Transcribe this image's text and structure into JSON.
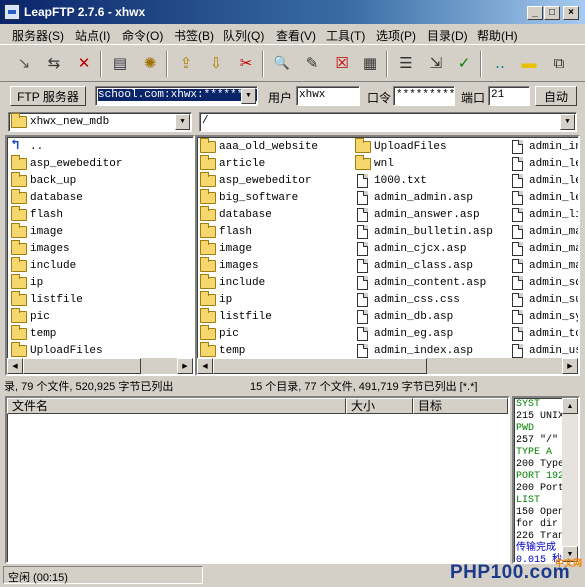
{
  "window": {
    "title": "LeapFTP 2.7.6 - xhwx",
    "min": "_",
    "max": "□",
    "close": "×"
  },
  "menu": [
    "服务器(S)",
    "站点(I)",
    "命令(O)",
    "书签(B)",
    "队列(Q)",
    "查看(V)",
    "工具(T)",
    "选项(P)",
    "目录(D)",
    "帮助(H)"
  ],
  "toolbar": {
    "icons": [
      "connect-icon",
      "quick-connect-icon",
      "disconnect-icon",
      "site-manager-icon",
      "settings-gear-icon",
      "upload-icon",
      "download-icon",
      "delete-icon",
      "find-icon",
      "edit-icon",
      "cancel-icon",
      "properties-icon",
      "queue-icon",
      "transfer-icon",
      "chart-icon",
      "dots-icon",
      "folder-icon",
      "maximize-icon"
    ],
    "glyphs": [
      "↘",
      "⇆",
      "✕",
      "▤",
      "✺",
      "⇪",
      "⇩",
      "✂",
      "🔍",
      "✎",
      "☒",
      "▦",
      "☰",
      "⇲",
      "✓",
      "‥",
      "▬",
      "⧉"
    ]
  },
  "connection": {
    "ftp_button": "FTP 服务器",
    "server_value": "school.com:xhwx:*********",
    "user_label": "用户",
    "user_value": "xhwx",
    "pass_label": "口令",
    "pass_value": "*********",
    "port_label": "端口",
    "port_value": "21",
    "auto_button": "自动"
  },
  "local": {
    "path": "xhwx_new_mdb",
    "parent": "..",
    "folders": [
      "asp_ewebeditor",
      "back_up",
      "database",
      "flash",
      "image",
      "images",
      "include",
      "ip",
      "listfile",
      "pic",
      "temp",
      "UploadFiles"
    ],
    "status": "录, 79 个文件, 520,925 字节已列出"
  },
  "remote": {
    "path": "/",
    "col1": [
      "aaa_old_website",
      "article",
      "asp_ewebeditor",
      "big_software",
      "database",
      "flash",
      "image",
      "images",
      "include",
      "ip",
      "listfile",
      "pic",
      "temp"
    ],
    "col2_folders": [
      "UploadFiles",
      "wnl"
    ],
    "col2_files": [
      "1000.txt",
      "admin_admin.asp",
      "admin_answer.asp",
      "admin_bulletin.asp",
      "admin_cjcx.asp",
      "admin_class.asp",
      "admin_content.asp",
      "admin_css.css",
      "admin_db.asp",
      "admin_eg.asp",
      "admin_index.asp"
    ],
    "col3_files": [
      "admin_inv",
      "admin_lef",
      "admin_lef",
      "admin_lef",
      "admin_lin",
      "admin_mai",
      "admin_man",
      "admin_man",
      "admin_sql",
      "admin_suf",
      "admin_sys",
      "admin_top",
      "admin_use"
    ],
    "status": "15 个目录, 77 个文件, 491,719 字节已列出 [*.*]"
  },
  "queue": {
    "col_filename": "文件名",
    "col_size": "大小",
    "col_target": "目标"
  },
  "log": {
    "lines": [
      {
        "text": "SYST",
        "color": "#008000"
      },
      {
        "text": "215 UNIX",
        "color": "#000000"
      },
      {
        "text": "PWD",
        "color": "#008000"
      },
      {
        "text": "257 \"/\"",
        "color": "#000000"
      },
      {
        "text": "TYPE A",
        "color": "#008000"
      },
      {
        "text": "200 Type",
        "color": "#000000"
      },
      {
        "text": "PORT 192",
        "color": "#008000"
      },
      {
        "text": "200 Port",
        "color": "#000000"
      },
      {
        "text": "LIST",
        "color": "#008000"
      },
      {
        "text": "150 Open",
        "color": "#000000"
      },
      {
        "text": "for dir",
        "color": "#000000"
      },
      {
        "text": "226 Tran",
        "color": "#000000"
      },
      {
        "text": "传输完成",
        "color": "#0000c0"
      },
      {
        "text": "0.015 秒",
        "color": "#0000c0"
      }
    ]
  },
  "statusbar": {
    "text": "空闲 (00:15)"
  },
  "watermark": {
    "text": "PHP100.com",
    "sub": "中文网"
  }
}
